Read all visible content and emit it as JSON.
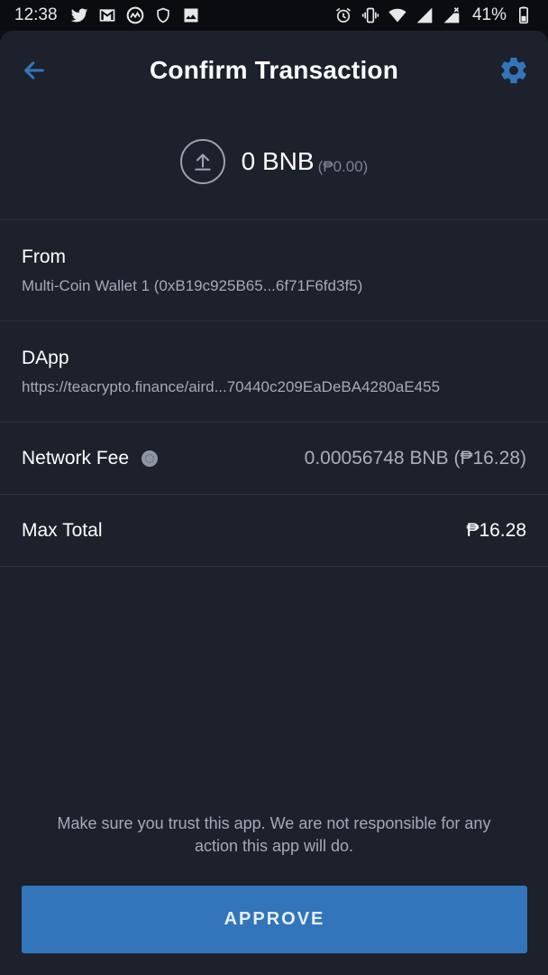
{
  "status_bar": {
    "time": "12:38",
    "battery": "41%",
    "left_icons": [
      "twitter-icon",
      "gmail-icon",
      "coinmarketcap-icon",
      "shield-icon",
      "image-icon"
    ],
    "right_icons": [
      "alarm-icon",
      "vibrate-icon",
      "wifi-icon",
      "signal-icon",
      "signal-x-icon",
      "battery-icon"
    ]
  },
  "header": {
    "title": "Confirm Transaction",
    "back_icon": "back-arrow-icon",
    "settings_icon": "gear-icon"
  },
  "amount": {
    "value": "0 BNB",
    "fiat": "(₱0.00)",
    "icon": "upload-icon"
  },
  "details": {
    "from_label": "From",
    "from_value": "Multi-Coin Wallet 1 (0xB19c925B65...6f71F6fd3f5)",
    "dapp_label": "DApp",
    "dapp_value": "https://teacrypto.finance/aird...70440c209EaDeBA4280aE455",
    "fee_label": "Network Fee",
    "fee_value": "0.00056748 BNB (₱16.28)",
    "fee_info_icon": "info-icon",
    "total_label": "Max Total",
    "total_value": "₱16.28"
  },
  "disclaimer": "Make sure you trust this app. We are not responsible for any action this app will do.",
  "approve_label": "APPROVE",
  "colors": {
    "accent": "#3375bb",
    "background": "#1c212b",
    "status_bar": "#0b0c10",
    "divider": "#2c323e"
  }
}
